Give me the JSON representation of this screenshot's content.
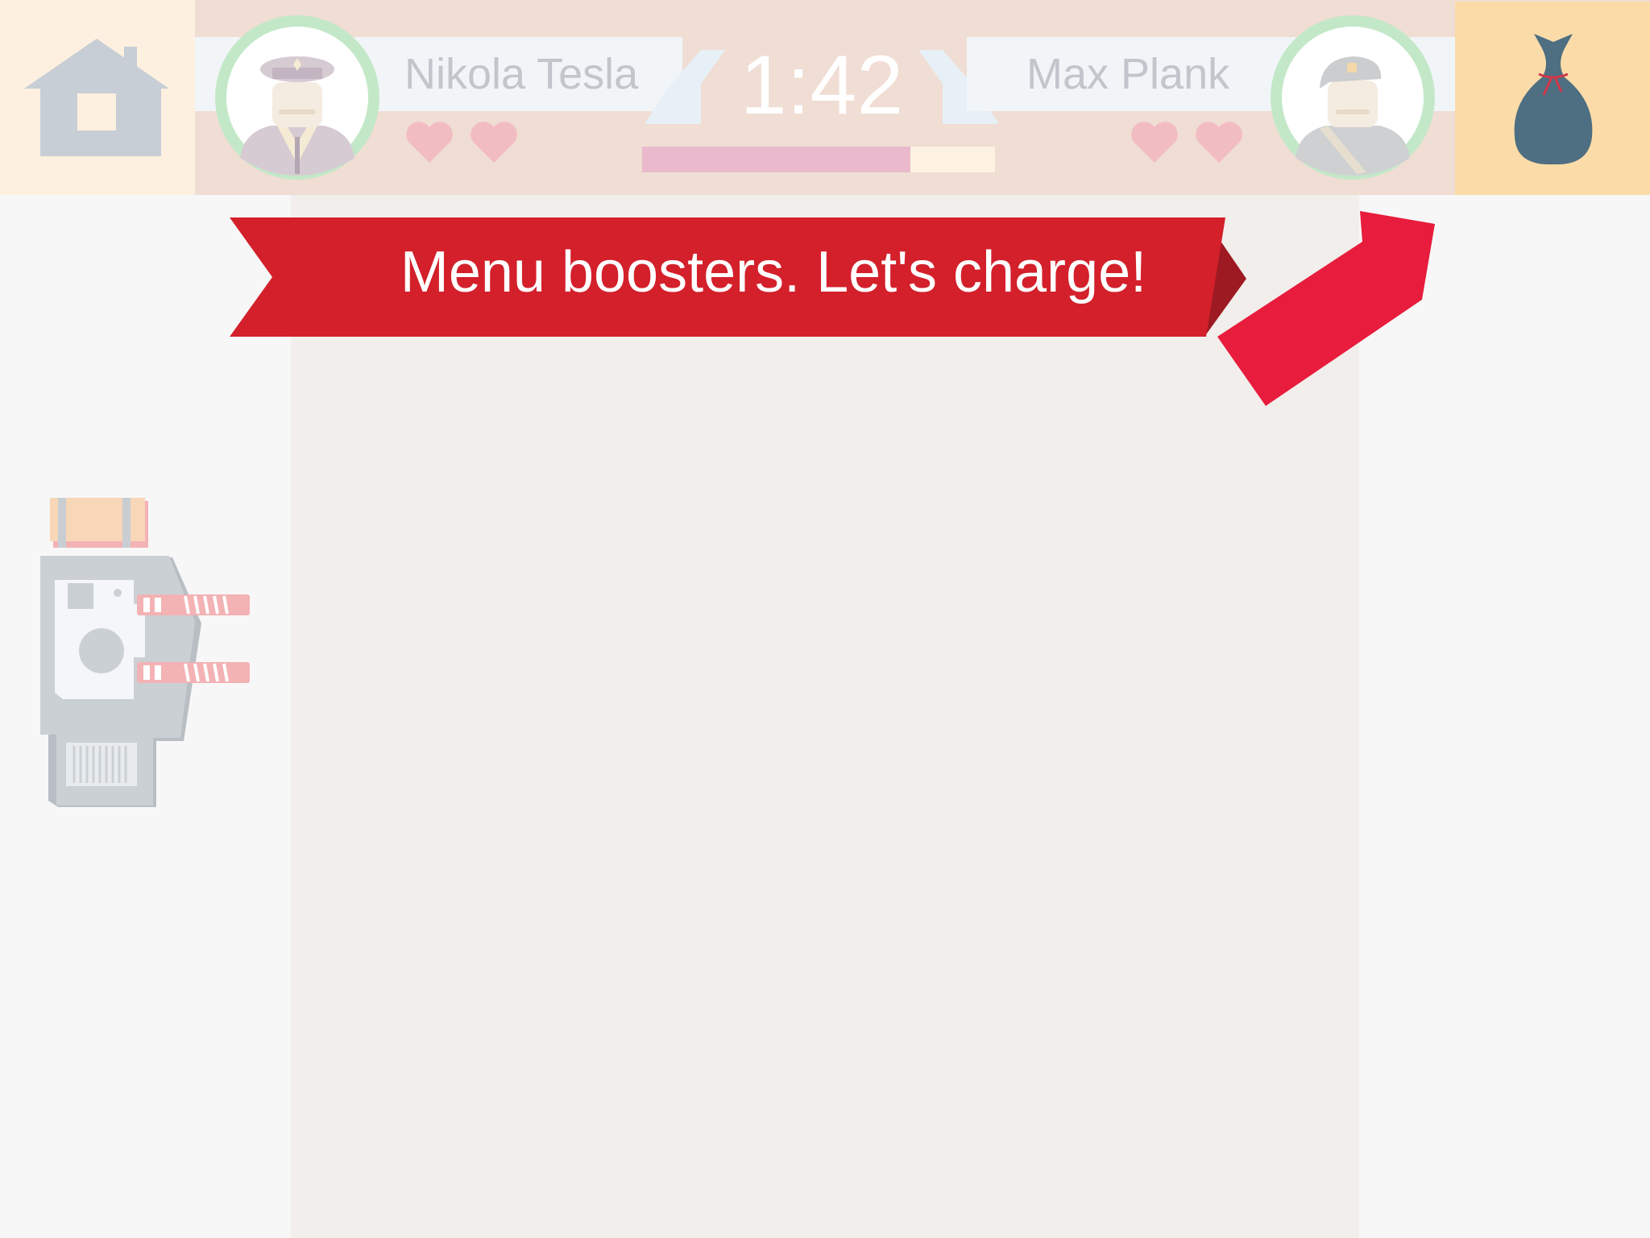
{
  "header": {
    "player_left": {
      "name": "Nikola Tesla",
      "lives": 2,
      "avatar": "officer-avatar-icon"
    },
    "player_right": {
      "name": "Max Plank",
      "lives": 2,
      "avatar": "soldier-avatar-icon"
    },
    "timer": "1:42",
    "turn_progress": 0.76,
    "home_icon": "house-icon",
    "bag_icon": "money-bag-icon"
  },
  "banner": {
    "text": "Menu boosters. Let's charge!"
  },
  "board": {
    "unit_icon": "twin-cannon-tank-icon"
  },
  "colors": {
    "banner_red": "#d3202b",
    "ribbon_red": "#e81c3c",
    "heart_pink": "#f2bcc3",
    "avatar_ring": "#c3e8c8",
    "progress_fill": "#ebb9cc",
    "bag_blue": "#4e6e82"
  }
}
